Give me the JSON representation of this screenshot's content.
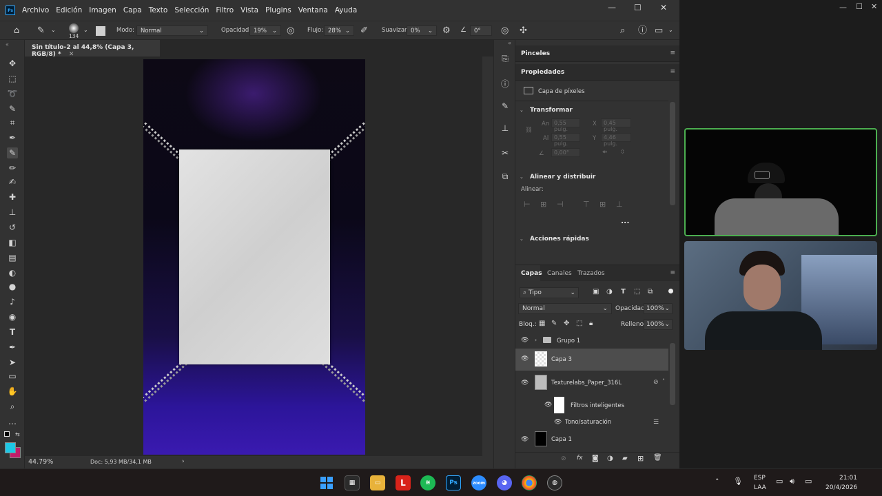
{
  "menubar": {
    "app_logo": "Ps",
    "items": [
      "Archivo",
      "Edición",
      "Imagen",
      "Capa",
      "Texto",
      "Selección",
      "Filtro",
      "Vista",
      "Plugins",
      "Ventana",
      "Ayuda"
    ]
  },
  "options": {
    "brush_size": "134",
    "mode_label": "Modo:",
    "mode_value": "Normal",
    "opacity_label": "Opacidad:",
    "opacity_value": "19%",
    "flow_label": "Flujo:",
    "flow_value": "28%",
    "smoothing_label": "Suavizar:",
    "smoothing_value": "0%",
    "angle_value": "0°"
  },
  "document": {
    "tab_title": "Sin título-2 al 44,8% (Capa 3, RGB/8) *",
    "zoom": "44.79%",
    "doc_info": "Doc: 5,93 MB/34,1 MB"
  },
  "panels": {
    "brushes_title": "Pinceles",
    "properties_title": "Propiedades",
    "pixel_layer_label": "Capa de píxeles",
    "transform_title": "Transformar",
    "an_label": "An",
    "an_value": "0,55 pulg.",
    "x_label": "X",
    "x_value": "0,45 pulg.",
    "al_label": "Al",
    "al_value": "0,55 pulg.",
    "y_label": "Y",
    "y_value": "4,46 pulg.",
    "angle_value": "0,00°",
    "align_title": "Alinear y distribuir",
    "align_label": "Alinear:",
    "more_label": "...",
    "quick_actions_title": "Acciones rápidas"
  },
  "layers_panel": {
    "tabs": [
      "Capas",
      "Canales",
      "Trazados"
    ],
    "filter_label": "Tipo",
    "blend_mode": "Normal",
    "opacity_label": "Opacidad:",
    "opacity_value": "100%",
    "lock_label": "Bloq.:",
    "fill_label": "Relleno:",
    "fill_value": "100%",
    "layers": [
      {
        "name": "Grupo 1"
      },
      {
        "name": "Capa 3"
      },
      {
        "name": "Texturelabs_Paper_316L"
      },
      {
        "name": "Filtros inteligentes"
      },
      {
        "name": "Tono/saturación"
      },
      {
        "name": "Capa 1"
      }
    ]
  },
  "taskbar": {
    "language_top": "ESP",
    "language_bottom": "LAA",
    "time": "21:01",
    "date": "20/4/2026"
  },
  "colors": {
    "foreground": "#1ec8e6",
    "background": "#c21b6a",
    "accent_border": "#4caf50"
  }
}
